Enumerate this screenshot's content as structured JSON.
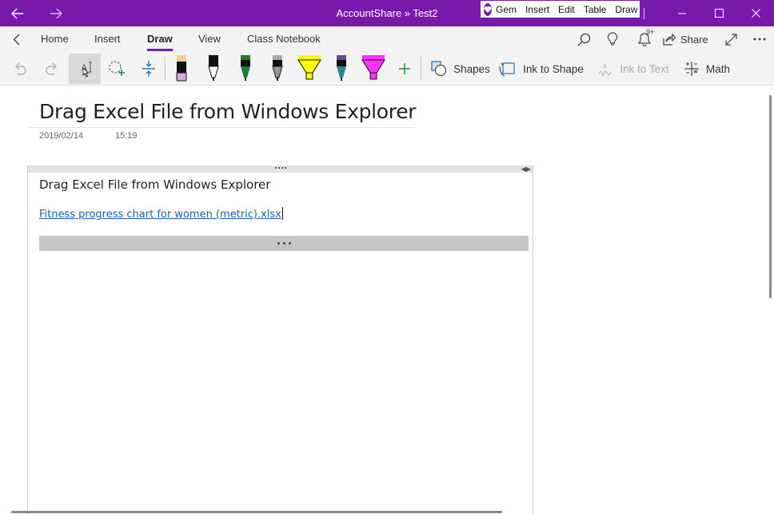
{
  "window": {
    "title": "AccountShare » Test2",
    "accent_color": "#7719aa"
  },
  "gem_menu": {
    "items": [
      "Gem",
      "Insert",
      "Edit",
      "Table",
      "Draw"
    ]
  },
  "ribbon": {
    "tabs": [
      "Home",
      "Insert",
      "Draw",
      "View",
      "Class Notebook"
    ],
    "active_tab": "Draw",
    "share_label": "Share",
    "notification_badge": "9+"
  },
  "draw_tools": {
    "shapes_label": "Shapes",
    "ink_to_shape_label": "Ink to Shape",
    "ink_to_text_label": "Ink to Text",
    "math_label": "Math",
    "pens": [
      {
        "name": "pen-black-lilac",
        "body": "#111111",
        "tip": "#d9a6d9",
        "cap": "#f2d08a"
      },
      {
        "name": "pen-black",
        "body": "#111111",
        "tip": "#ffffff",
        "cap": "#111111"
      },
      {
        "name": "pen-green",
        "body": "#111111",
        "tip": "#1e7e34",
        "cap": "#1e7e34"
      },
      {
        "name": "pen-gray",
        "body": "#111111",
        "tip": "#777777",
        "cap": "#aaaaaa"
      },
      {
        "name": "highlighter-yellow",
        "body": "#ffff00",
        "tip": "#ffff00",
        "cap": "#ffff00"
      },
      {
        "name": "pen-galaxy",
        "body": "#111111",
        "tip": "#2d8a8a",
        "cap": "#6a4c93"
      },
      {
        "name": "highlighter-magenta",
        "body": "#ff33ff",
        "tip": "#ff33ff",
        "cap": "#ff33ff"
      }
    ]
  },
  "page": {
    "title": "Drag Excel File from Windows Explorer",
    "date": "2019/02/14",
    "time": "15:19",
    "outline_heading": "Drag Excel File from Windows Explorer",
    "file_link": "Fitness progress chart for women (metric).xlsx"
  }
}
